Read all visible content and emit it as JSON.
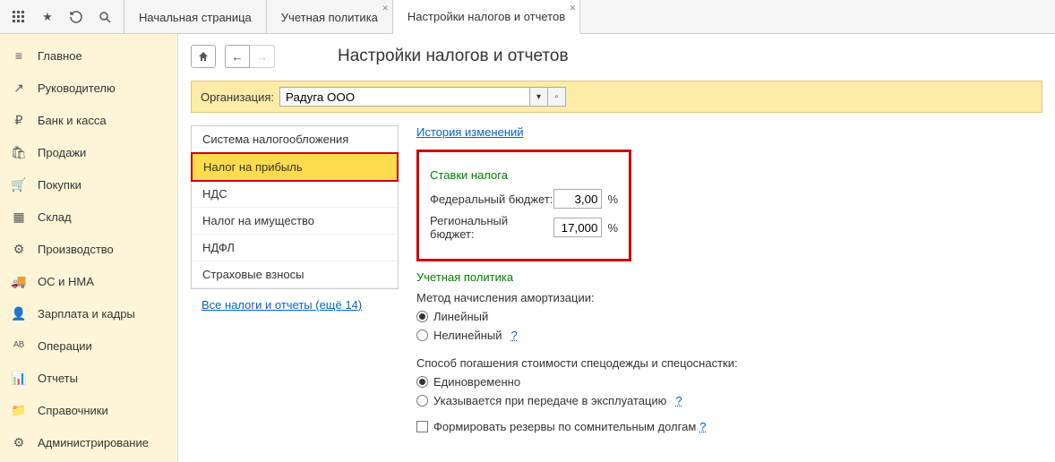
{
  "tabs": {
    "t0": "Начальная страница",
    "t1": "Учетная политика",
    "t2": "Настройки налогов и отчетов"
  },
  "sidebar": {
    "items": [
      {
        "label": "Главное",
        "icon": "≡"
      },
      {
        "label": "Руководителю",
        "icon": "↗"
      },
      {
        "label": "Банк и касса",
        "icon": "₽"
      },
      {
        "label": "Продажи",
        "icon": "🛍"
      },
      {
        "label": "Покупки",
        "icon": "🛒"
      },
      {
        "label": "Склад",
        "icon": "▦"
      },
      {
        "label": "Производство",
        "icon": "⚙"
      },
      {
        "label": "ОС и НМА",
        "icon": "🚚"
      },
      {
        "label": "Зарплата и кадры",
        "icon": "👤"
      },
      {
        "label": "Операции",
        "icon": "ᴬᴮ"
      },
      {
        "label": "Отчеты",
        "icon": "📊"
      },
      {
        "label": "Справочники",
        "icon": "📁"
      },
      {
        "label": "Администрирование",
        "icon": "⚙"
      }
    ]
  },
  "page": {
    "title": "Настройки налогов и отчетов"
  },
  "org": {
    "label": "Организация:",
    "value": "Радуга ООО"
  },
  "nav_menu": {
    "items": [
      "Система налогообложения",
      "Налог на прибыль",
      "НДС",
      "Налог на имущество",
      "НДФЛ",
      "Страховые взносы"
    ],
    "active_index": 1,
    "all_link": "Все налоги и отчеты (ещё 14)"
  },
  "detail": {
    "history_link": "История изменений",
    "rates": {
      "title": "Ставки налога",
      "federal": {
        "label": "Федеральный бюджет:",
        "value": "3,00"
      },
      "regional": {
        "label": "Региональный бюджет:",
        "value": "17,000"
      },
      "percent": "%"
    },
    "policy_title": "Учетная политика",
    "amort": {
      "label": "Метод начисления амортизации:",
      "linear": "Линейный",
      "nonlinear": "Нелинейный"
    },
    "spec": {
      "label": "Способ погашения стоимости спецодежды и спецоснастки:",
      "once": "Единовременно",
      "transfer": "Указывается при передаче в эксплуатацию"
    },
    "reserves": "Формировать резервы по сомнительным долгам",
    "help": "?"
  }
}
